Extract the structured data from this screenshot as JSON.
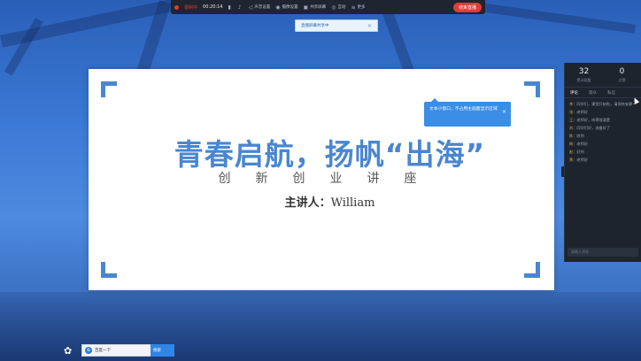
{
  "topbar": {
    "rec_label": "录制中",
    "time": "00:20:14",
    "items": [
      {
        "icon": "signal-icon",
        "label": "",
        "glyph": "▮"
      },
      {
        "icon": "mic-icon",
        "label": "",
        "glyph": "🎤"
      },
      {
        "icon": "speaker-icon",
        "label": "声音设置",
        "glyph": "🔊"
      },
      {
        "icon": "camera-icon",
        "label": "摄像设置",
        "glyph": "◉"
      },
      {
        "icon": "share-icon",
        "label": "共享屏幕",
        "glyph": "▣"
      },
      {
        "icon": "interaction-icon",
        "label": "互动",
        "glyph": "◎"
      },
      {
        "icon": "dashboard-icon",
        "label": "更多",
        "glyph": "≡"
      }
    ],
    "end_button": "结束直播"
  },
  "notification": {
    "text": "直播屏幕共享中",
    "close": "×"
  },
  "slide": {
    "title": "青春启航，扬帆“出海”",
    "subtitle": "创新创业讲座",
    "speaker_label": "主讲人：",
    "speaker_name": "William"
  },
  "tooltip": {
    "text": "文本小窗口，不占用主画面显示区域",
    "close": "×"
  },
  "panel": {
    "stats": [
      {
        "num": "32",
        "label": "累计观看"
      },
      {
        "num": "0",
        "label": "点赞"
      }
    ],
    "tabs": [
      "评论",
      "观众",
      "私信"
    ],
    "messages": [
      {
        "user": "李",
        "text": "同学们，课堂开始啦，请保持安静~"
      },
      {
        "user": "张",
        "text": "老师好"
      },
      {
        "user": "王",
        "text": "老师好，听得很清楚"
      },
      {
        "user": "刘",
        "text": "同学们好，准备好了"
      },
      {
        "user": "陈",
        "text": "收到"
      },
      {
        "user": "杨",
        "text": "老师好"
      },
      {
        "user": "赵",
        "text": "好的"
      },
      {
        "user": "黄",
        "text": "老师好"
      }
    ],
    "input_placeholder": "请输入消息"
  },
  "taskbar": {
    "ie_label": "百度一下",
    "search_label": "搜索"
  }
}
